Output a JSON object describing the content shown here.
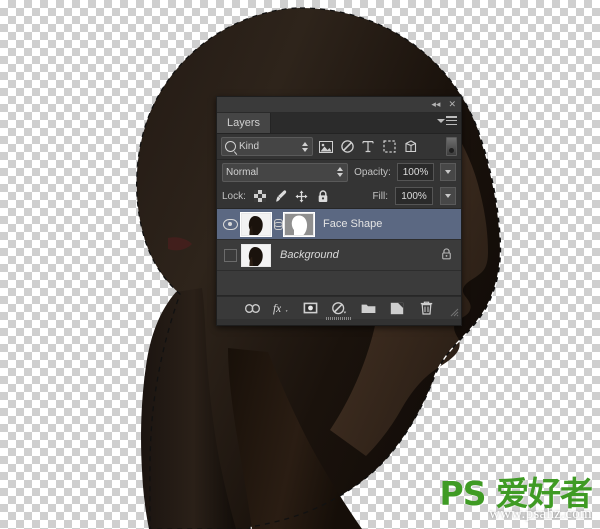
{
  "canvas": {
    "background": "transparency-checkerboard",
    "subject": "woman-head-profile-silhouette",
    "selection": "marching-ants-outline"
  },
  "panel": {
    "topbar": {
      "collapse_label": "◂◂",
      "close_label": "✕"
    },
    "tabs": [
      {
        "label": "Layers",
        "active": true
      }
    ],
    "menu_icon": "panel-menu-icon",
    "filter_row": {
      "kind_label": "Kind",
      "search_icon": "search-icon",
      "icons": [
        "pixel-layer-filter-icon",
        "adjustment-layer-filter-icon",
        "type-layer-filter-icon",
        "shape-layer-filter-icon",
        "smart-object-filter-icon"
      ],
      "toggle": "filter-enable-toggle"
    },
    "blend_row": {
      "blend_mode": "Normal",
      "opacity_label": "Opacity:",
      "opacity_value": "100%"
    },
    "lock_row": {
      "lock_label": "Lock:",
      "lock_icons": [
        "lock-transparent-pixels-icon",
        "lock-image-pixels-icon",
        "lock-position-icon",
        "lock-all-icon"
      ],
      "fill_label": "Fill:",
      "fill_value": "100%"
    },
    "layers": [
      {
        "name": "Face Shape",
        "visible": true,
        "selected": true,
        "has_mask": true,
        "linked": true,
        "locked": false,
        "italic": false
      },
      {
        "name": "Background",
        "visible": false,
        "selected": false,
        "has_mask": false,
        "linked": false,
        "locked": true,
        "italic": true
      }
    ],
    "bottom_bar": {
      "buttons": [
        "link-layers-icon",
        "layer-style-fx-icon",
        "add-layer-mask-icon",
        "new-adjustment-layer-icon",
        "new-group-icon",
        "new-layer-icon",
        "delete-layer-icon"
      ]
    }
  },
  "watermark": {
    "logo": "PS 爱好者",
    "url": "www.psahz.com",
    "color": "#3f9b24"
  }
}
